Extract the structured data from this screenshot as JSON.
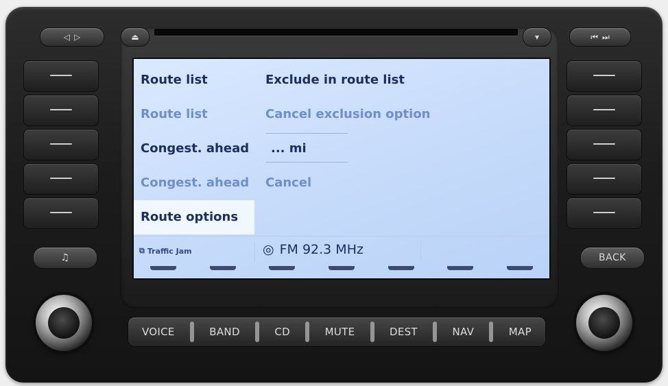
{
  "menu": {
    "rows": [
      {
        "left": "Route list",
        "right": "Exclude in route list"
      },
      {
        "left": "Route list",
        "right": "Cancel exclusion option"
      },
      {
        "left": "Congest. ahead",
        "right": "... mi"
      },
      {
        "left": "Congest. ahead",
        "right": "Cancel"
      },
      {
        "left": "Route options",
        "right": ""
      }
    ]
  },
  "status": {
    "traffic_label": "Traffic Jam",
    "radio_label": "FM  92.3 MHz",
    "traffic_icon": "traffic-icon",
    "radio_icon": "radio-signal-icon"
  },
  "hardware": {
    "bottom_keys": [
      "VOICE",
      "BAND",
      "CD",
      "MUTE",
      "DEST",
      "NAV",
      "MAP"
    ],
    "back_label": "BACK",
    "music_icon": "music-note-icon"
  },
  "colors": {
    "screen_bg": "#c9ddfb",
    "text_active": "#1b2f63",
    "text_dim": "#6e8fce"
  }
}
